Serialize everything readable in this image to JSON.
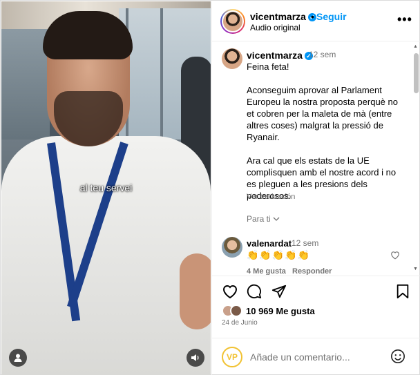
{
  "video": {
    "subtitle": "al teu servei",
    "icons": [
      "user-icon",
      "audio-icon"
    ]
  },
  "header": {
    "username": "vicentmarza",
    "separator": "•",
    "follow_label": "Seguir",
    "audio_label": "Audio original",
    "more_label": "•••"
  },
  "caption": {
    "username": "vicentmarza",
    "time": "12 sem",
    "text": "Feina feta!\n\nAconseguim aprovar al Parlament Europeu la nostra proposta perquè no et cobren per la maleta de mà (entre altres coses) malgrat la pressió de Ryanair.\n\nAra cal que els estats de la UE complisquen amb el nostre acord i no es pleguen a les presions dels poderosos.",
    "translate_label": "Ver traducción",
    "for_you_label": "Para ti"
  },
  "comment": {
    "username": "valenardat",
    "time": "12 sem",
    "text": "👏👏👏👏👏",
    "likes_label": "4 Me gusta",
    "reply_label": "Responder"
  },
  "footer": {
    "likes": "10 969 Me gusta",
    "date": "24 de Junio",
    "comment_placeholder": "Añade un comentario...",
    "avatar_text": "VP"
  },
  "colors": {
    "accent": "#0095f6",
    "muted": "#737373",
    "border": "#efefef"
  }
}
